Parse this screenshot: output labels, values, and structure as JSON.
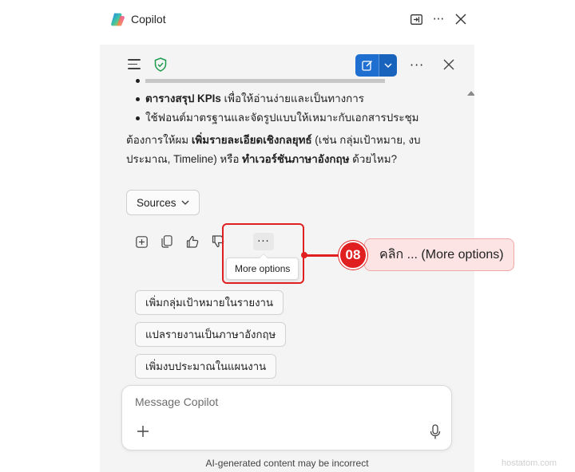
{
  "window": {
    "title": "Copilot"
  },
  "pane": {
    "bullets": [
      {
        "text": ""
      },
      {
        "bold": "ตารางสรุป KPIs",
        "rest": " เพื่อให้อ่านง่ายและเป็นทางการ"
      },
      {
        "bold": "",
        "rest": "ใช้ฟอนต์มาตรฐานและจัดรูปแบบให้เหมาะกับเอกสารประชุม"
      }
    ],
    "closing": {
      "t1": "ต้องการให้ผม ",
      "b1": "เพิ่มรายละเอียดเชิงกลยุทธ์",
      "t2": " (เช่น กลุ่มเป้าหมาย, งบประมาณ, Timeline) หรือ ",
      "b2": "ทำเวอร์ชันภาษาอังกฤษ",
      "t3": " ด้วยไหม?"
    },
    "sources_label": "Sources",
    "more_options_glyph": "···",
    "tooltip": "More options",
    "suggestions": [
      "เพิ่มกลุ่มเป้าหมายในรายงาน",
      "แปลรายงานเป็นภาษาอังกฤษ",
      "เพิ่มงบประมาณในแผนงาน"
    ],
    "composer_placeholder": "Message Copilot",
    "disclaimer": "AI-generated content may be incorrect"
  },
  "annotation": {
    "step": "08",
    "text": "คลิก ... (More options)"
  },
  "watermark": "hostatom.com",
  "colors": {
    "accent": "#1f6fd1",
    "highlight": "#e02020",
    "callout_bg": "#fde4e4"
  }
}
